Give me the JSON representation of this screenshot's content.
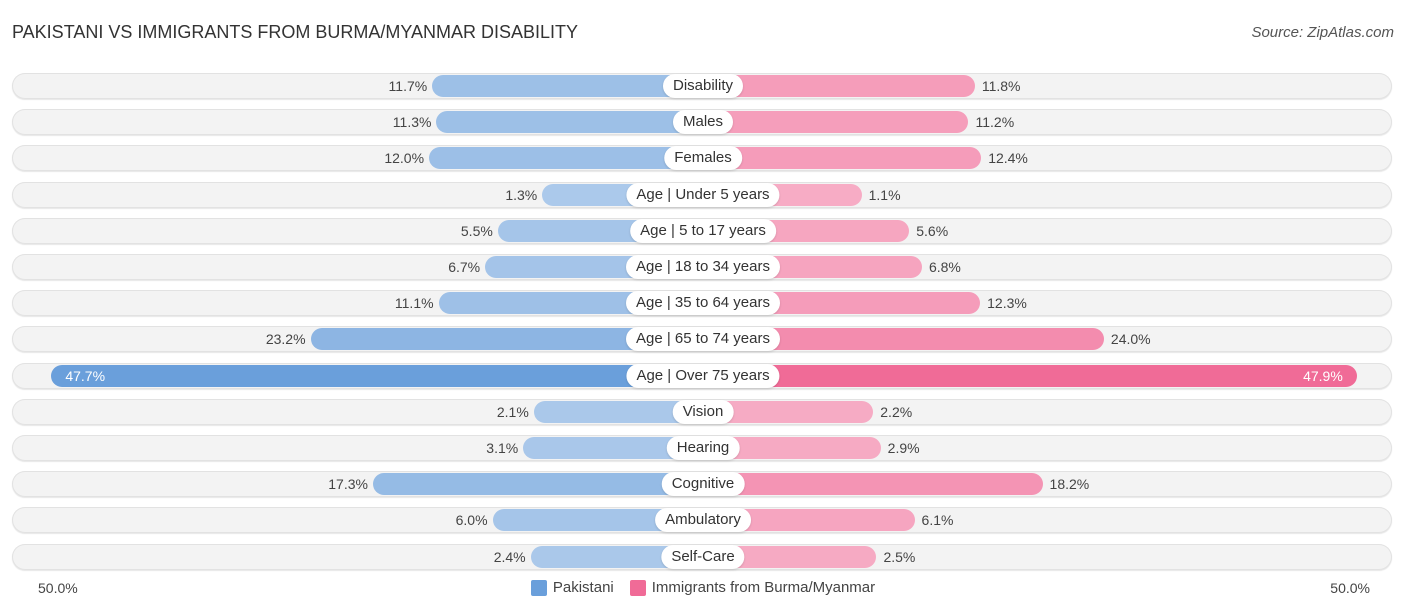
{
  "chart_data": {
    "type": "bar",
    "orientation": "diverging-horizontal",
    "title": "PAKISTANI VS IMMIGRANTS FROM BURMA/MYANMAR DISABILITY",
    "source": "Source: ZipAtlas.com",
    "categories": [
      "Disability",
      "Males",
      "Females",
      "Age | Under 5 years",
      "Age | 5 to 17 years",
      "Age | 18 to 34 years",
      "Age | 35 to 64 years",
      "Age | 65 to 74 years",
      "Age | Over 75 years",
      "Vision",
      "Hearing",
      "Cognitive",
      "Ambulatory",
      "Self-Care"
    ],
    "series": [
      {
        "name": "Pakistani",
        "color": "#6a9fdb",
        "values": [
          11.7,
          11.3,
          12.0,
          1.3,
          5.5,
          6.7,
          11.1,
          23.2,
          47.7,
          2.1,
          3.1,
          17.3,
          6.0,
          2.4
        ]
      },
      {
        "name": "Immigrants from Burma/Myanmar",
        "color": "#f06b97",
        "values": [
          11.8,
          11.2,
          12.4,
          1.1,
          5.6,
          6.8,
          12.3,
          24.0,
          47.9,
          2.2,
          2.9,
          18.2,
          6.1,
          2.5
        ]
      }
    ],
    "value_suffix": "%",
    "axis": {
      "left_label": "50.0%",
      "right_label": "50.0%",
      "max": 50.0
    },
    "legend_position": "bottom-center"
  }
}
